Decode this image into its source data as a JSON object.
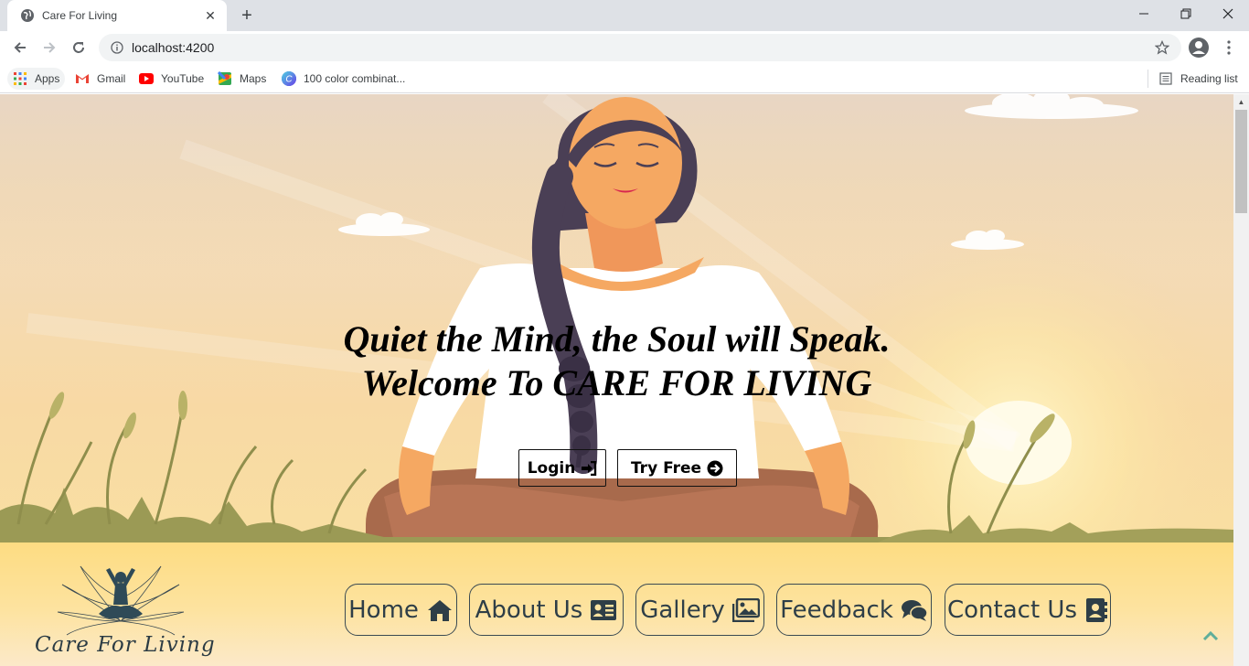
{
  "browser": {
    "tab_title": "Care For Living",
    "url": "localhost:4200",
    "bookmarks": [
      {
        "label": "Apps",
        "icon": "apps-grid-icon"
      },
      {
        "label": "Gmail",
        "icon": "gmail-icon"
      },
      {
        "label": "YouTube",
        "icon": "youtube-icon"
      },
      {
        "label": "Maps",
        "icon": "maps-icon"
      },
      {
        "label": "100 color combinat...",
        "icon": "canva-icon"
      }
    ],
    "reading_list": "Reading list"
  },
  "hero": {
    "line1": "Quiet the Mind, the Soul will Speak.",
    "line2": "Welcome To CARE FOR LIVING",
    "login_label": "Login",
    "try_free_label": "Try Free"
  },
  "footer_nav": {
    "logo_text": "Care For Living",
    "items": [
      {
        "label": "Home",
        "icon": "home-icon"
      },
      {
        "label": "About Us",
        "icon": "id-card-icon"
      },
      {
        "label": "Gallery",
        "icon": "images-icon"
      },
      {
        "label": "Feedback",
        "icon": "comments-icon"
      },
      {
        "label": "Contact Us",
        "icon": "address-book-icon"
      }
    ]
  },
  "colors": {
    "nav_text": "#2e3e47",
    "hair": "#4a3f55",
    "skin": "#f5a862",
    "pants": "#a86a4c",
    "grass": "#9b9a55"
  }
}
